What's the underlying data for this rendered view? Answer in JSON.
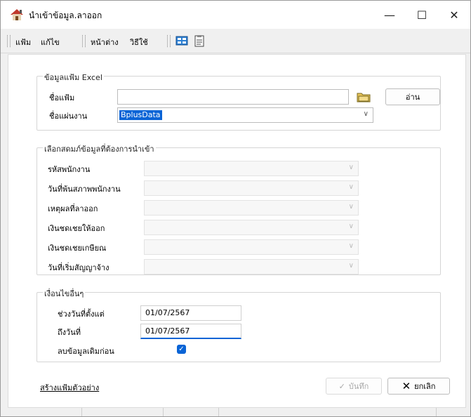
{
  "window": {
    "title": "นำเข้าข้อมูล.ลาออก",
    "controls": {
      "minimize": "—",
      "maximize": "☐",
      "close": "✕"
    }
  },
  "menu": {
    "items": [
      "แฟ้ม",
      "แก้ไข",
      "หน้าต่าง",
      "วิธีใช้"
    ]
  },
  "excel_group": {
    "title": "ข้อมูลแฟ้ม Excel",
    "file_label": "ชื่อแฟ้ม",
    "file_value": "",
    "sheet_label": "ชื่อแผ่นงาน",
    "sheet_value": "BplusData",
    "read_button": "อ่าน"
  },
  "columns_group": {
    "title": "เลือกสดมภ์ข้อมูลที่ต้องการนำเข้า",
    "rows": [
      {
        "label": "รหัสพนักงาน",
        "value": ""
      },
      {
        "label": "วันที่พ้นสภาพพนักงาน",
        "value": ""
      },
      {
        "label": "เหตุผลที่ลาออก",
        "value": ""
      },
      {
        "label": "เงินชดเชยให้ออก",
        "value": ""
      },
      {
        "label": "เงินชดเชยเกษียณ",
        "value": ""
      },
      {
        "label": "วันที่เริ่มสัญญาจ้าง",
        "value": ""
      }
    ]
  },
  "conditions_group": {
    "title": "เงื่อนไขอื่นๆ",
    "from_label": "ช่วงวันที่ตั้งแต่",
    "from_value": "01/07/2567",
    "to_label": "ถึงวันที่",
    "to_value": "01/07/2567",
    "clear_label": "ลบข้อมูลเดิมก่อน",
    "clear_checked": true
  },
  "footer": {
    "sample_link": "สร้างแฟ้มตัวอย่าง",
    "save_button": "บันทึก",
    "cancel_button": "ยกเลิก"
  },
  "icons": {
    "app": "house-icon",
    "folder": "folder-icon",
    "check": "checkmark-icon",
    "save": "checkmark-icon",
    "cancel": "x-icon"
  },
  "colors": {
    "accent": "#0a64d6",
    "background": "#f0f0f0",
    "panel": "#ffffff"
  }
}
